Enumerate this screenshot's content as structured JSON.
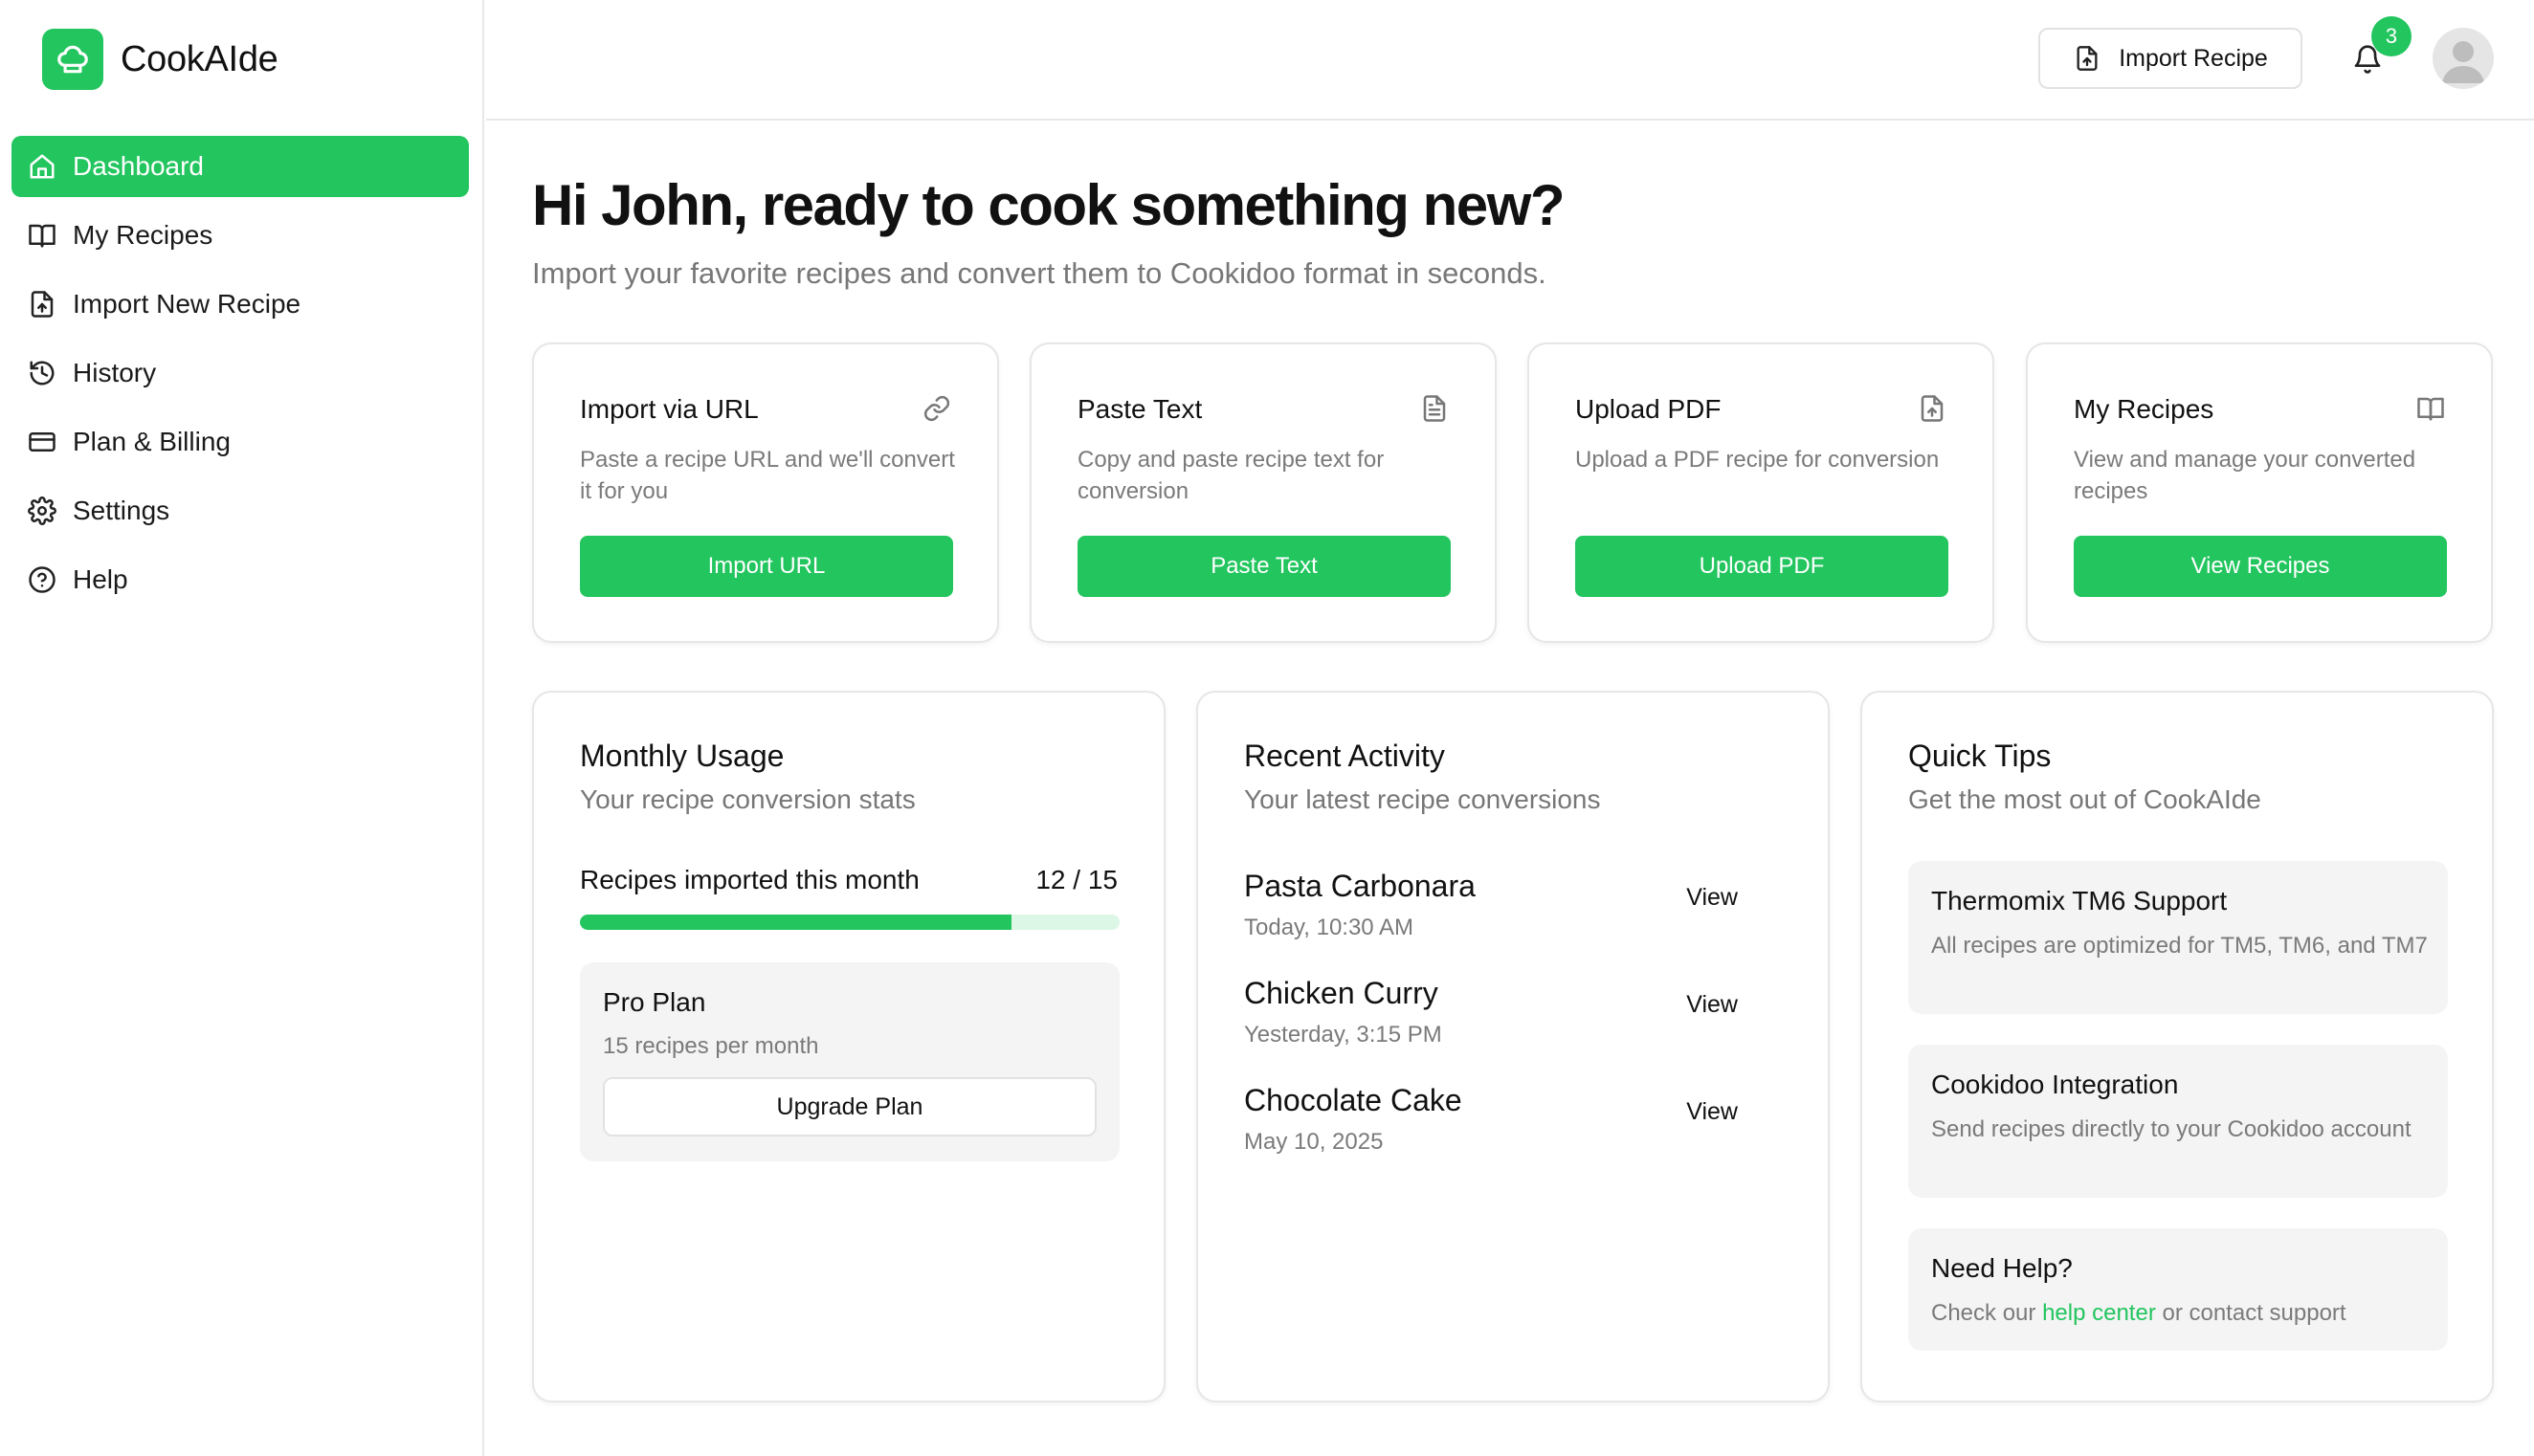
{
  "brand": {
    "name": "CookAIde"
  },
  "colors": {
    "accent": "#22c55e",
    "accent_light": "#dcf7e5",
    "muted_text": "#7a7a7a"
  },
  "sidebar": {
    "items": [
      {
        "label": "Dashboard",
        "icon": "home-icon",
        "active": true
      },
      {
        "label": "My Recipes",
        "icon": "book-icon"
      },
      {
        "label": "Import New Recipe",
        "icon": "file-upload-icon"
      },
      {
        "label": "History",
        "icon": "history-icon"
      },
      {
        "label": "Plan & Billing",
        "icon": "credit-card-icon"
      },
      {
        "label": "Settings",
        "icon": "gear-icon"
      },
      {
        "label": "Help",
        "icon": "help-circle-icon"
      }
    ]
  },
  "header": {
    "import_label": "Import Recipe",
    "notification_count": "3"
  },
  "main": {
    "greeting": "Hi John, ready to cook something new?",
    "subtitle": "Import your favorite recipes and convert them to Cookidoo format in seconds.",
    "actions": [
      {
        "title": "Import via URL",
        "desc": "Paste a recipe URL and we'll convert it for you",
        "button": "Import URL",
        "icon": "link-icon"
      },
      {
        "title": "Paste Text",
        "desc": "Copy and paste recipe text for conversion",
        "button": "Paste Text",
        "icon": "document-icon"
      },
      {
        "title": "Upload PDF",
        "desc": "Upload a PDF recipe for conversion",
        "button": "Upload PDF",
        "icon": "file-upload-icon"
      },
      {
        "title": "My Recipes",
        "desc": "View and manage your converted recipes",
        "button": "View Recipes",
        "icon": "book-icon"
      }
    ],
    "usage": {
      "title": "Monthly Usage",
      "subtitle": "Your recipe conversion stats",
      "label": "Recipes imported this month",
      "count": "12 / 15",
      "used": 12,
      "limit": 15,
      "plan_name": "Pro Plan",
      "plan_desc": "15 recipes per month",
      "upgrade_label": "Upgrade Plan"
    },
    "activity": {
      "title": "Recent Activity",
      "subtitle": "Your latest recipe conversions",
      "view_label": "View",
      "items": [
        {
          "name": "Pasta Carbonara",
          "time": "Today, 10:30 AM"
        },
        {
          "name": "Chicken Curry",
          "time": "Yesterday, 3:15 PM"
        },
        {
          "name": "Chocolate Cake",
          "time": "May 10, 2025"
        }
      ]
    },
    "tips": {
      "title": "Quick Tips",
      "subtitle": "Get the most out of CookAIde",
      "items": [
        {
          "title": "Thermomix TM6 Support",
          "desc": "All recipes are optimized for TM5, TM6, and TM7"
        },
        {
          "title": "Cookidoo Integration",
          "desc": "Send recipes directly to your Cookidoo account"
        },
        {
          "title": "Need Help?",
          "desc_before": "Check our ",
          "link": "help center",
          "desc_after": " or contact support"
        }
      ]
    }
  }
}
